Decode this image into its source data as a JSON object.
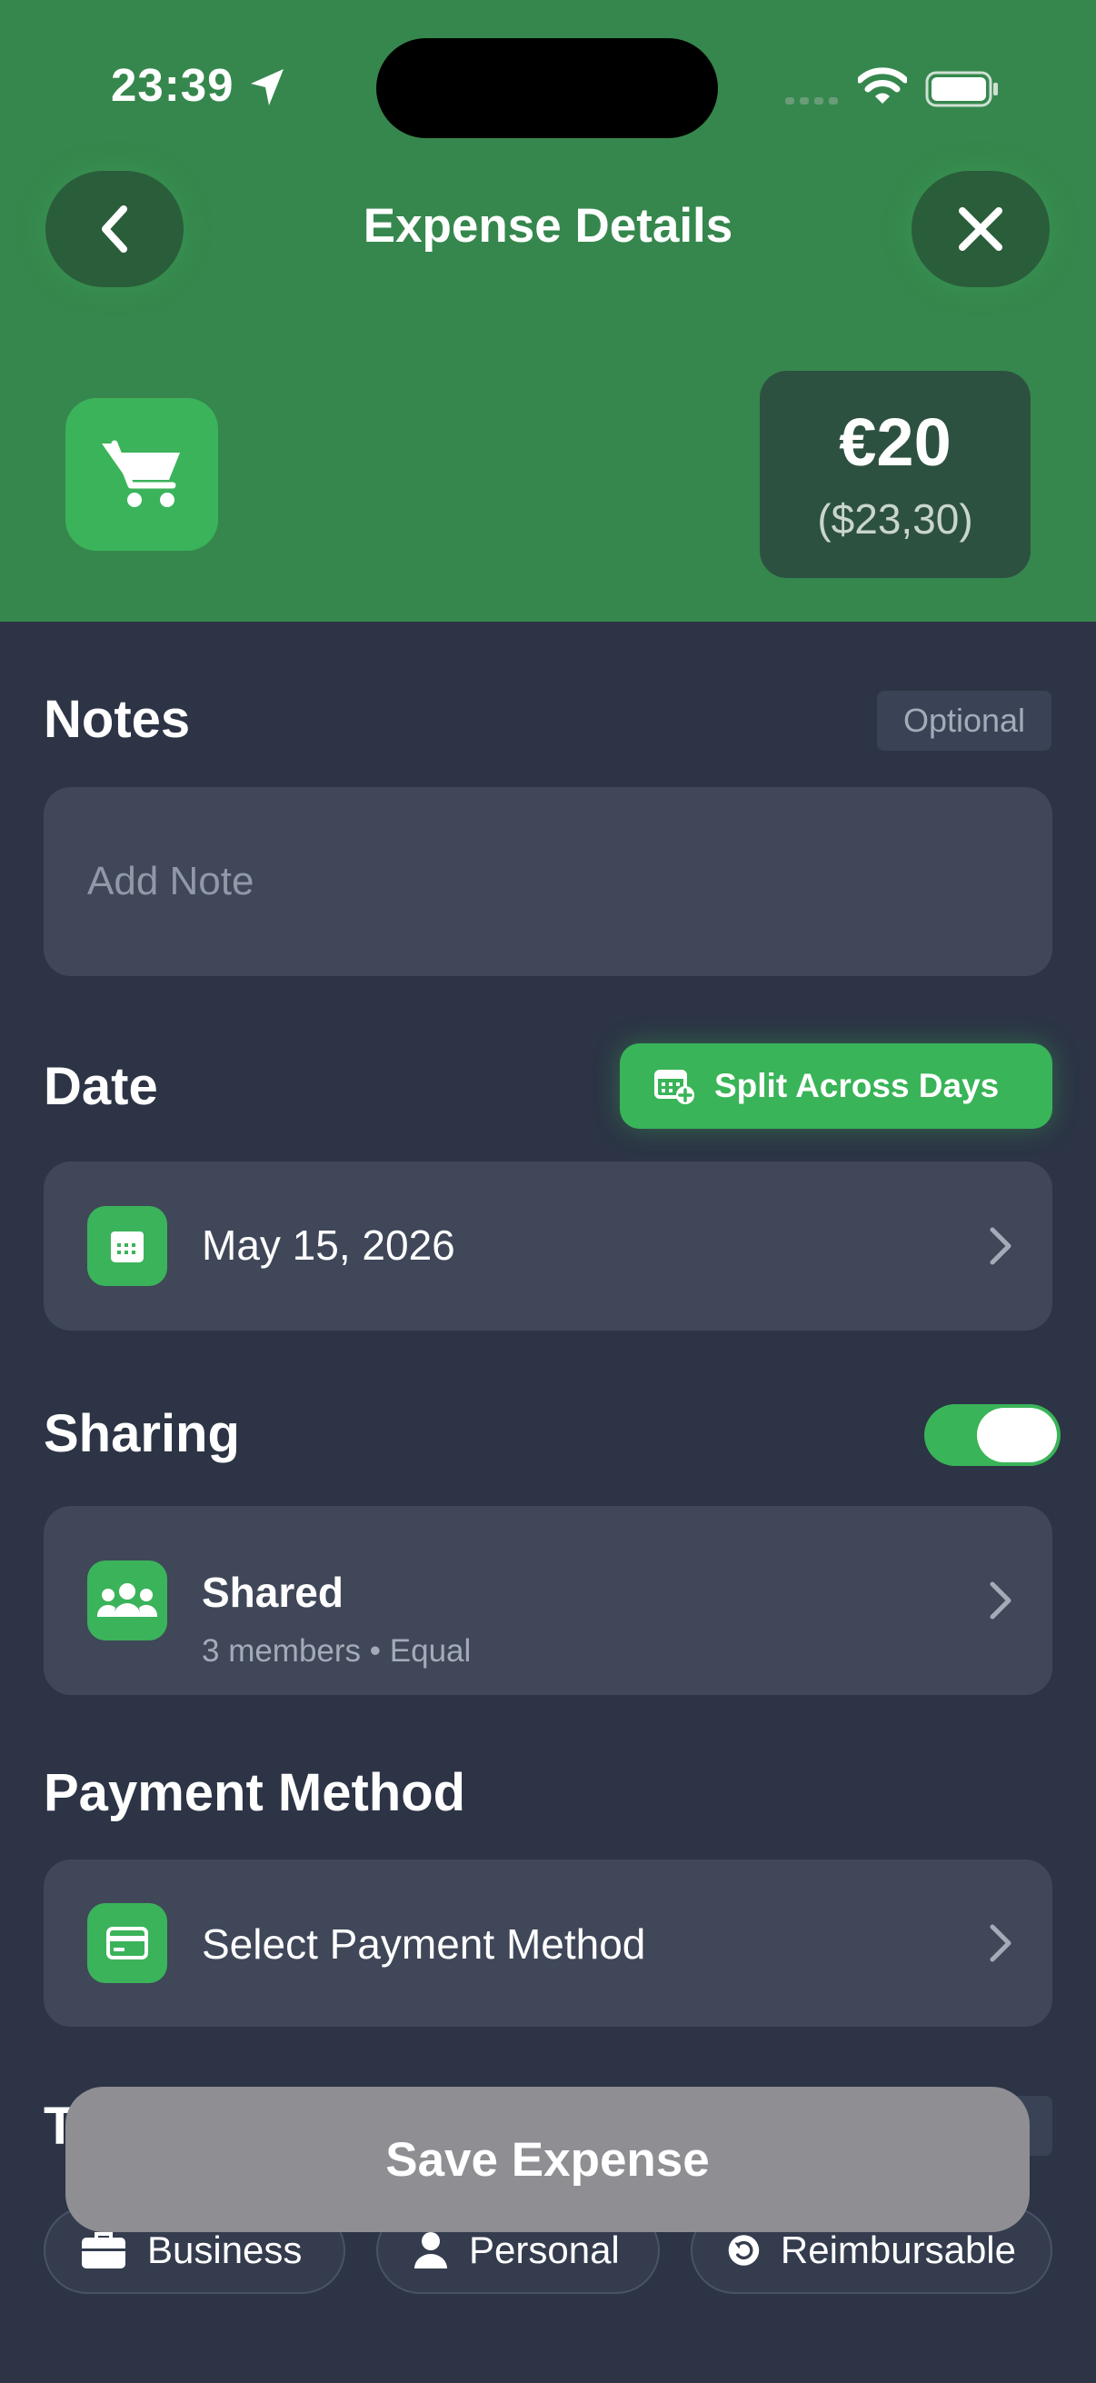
{
  "status_bar": {
    "time": "23:39"
  },
  "header": {
    "title": "Expense Details",
    "category_icon": "shopping-cart-icon",
    "amount": "€20",
    "converted_amount": "($23,30)"
  },
  "notes": {
    "title": "Notes",
    "badge": "Optional",
    "placeholder": "Add Note"
  },
  "date": {
    "title": "Date",
    "split_button": "Split Across Days",
    "value": "May 15, 2026"
  },
  "sharing": {
    "title": "Sharing",
    "enabled": true,
    "mode": "Shared",
    "details": "3 members • Equal"
  },
  "payment": {
    "title": "Payment Method",
    "value": "Select Payment Method"
  },
  "tags": {
    "title_peek": "T",
    "chips": [
      {
        "label": "Business",
        "icon": "briefcase-icon"
      },
      {
        "label": "Personal",
        "icon": "person-icon"
      },
      {
        "label": "Reimbursable",
        "icon": "refund-icon"
      }
    ]
  },
  "save_button": {
    "label": "Save Expense"
  },
  "colors": {
    "header_green": "#36874d",
    "accent_green": "#39b458",
    "background": "#2c3445",
    "card": "#3f4759",
    "save_disabled": "#8e8e93"
  }
}
